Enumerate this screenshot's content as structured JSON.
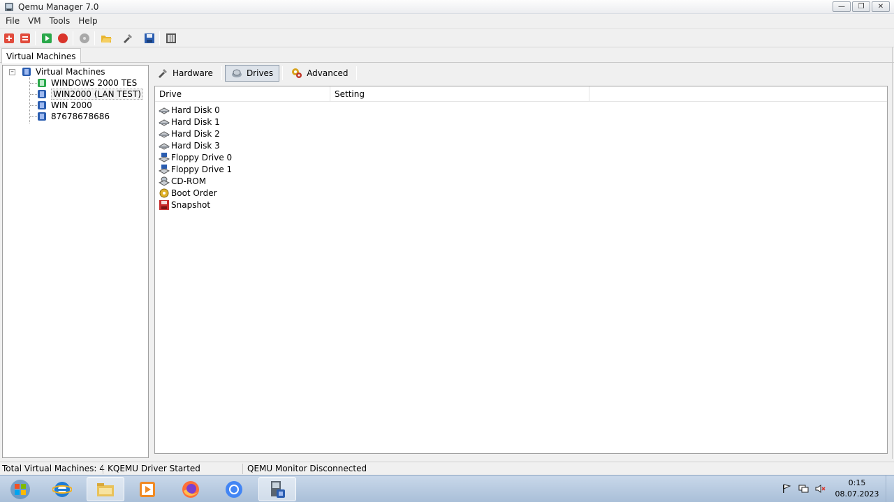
{
  "window": {
    "title": "Qemu Manager 7.0",
    "controls": [
      "minimize",
      "maximize",
      "close"
    ]
  },
  "menu": [
    "File",
    "VM",
    "Tools",
    "Help"
  ],
  "toolbar": {
    "buttons": [
      "add-vm",
      "remove-vm",
      "start-vm",
      "stop-vm",
      "disc",
      "open-folder",
      "settings",
      "save",
      "monitor"
    ]
  },
  "left_tab": "Virtual Machines",
  "tree": {
    "root": "Virtual Machines",
    "items": [
      "WINDOWS 2000 TES",
      "WIN2000 (LAN TEST)",
      "WIN 2000",
      "87678678686"
    ]
  },
  "subtabs": {
    "hardware": "Hardware",
    "drives": "Drives",
    "advanced": "Advanced"
  },
  "listview": {
    "columns": [
      "Drive",
      "Setting"
    ],
    "rows": [
      "Hard Disk 0",
      "Hard Disk 1",
      "Hard Disk 2",
      "Hard Disk 3",
      "Floppy Drive 0",
      "Floppy Drive 1",
      "CD-ROM",
      "Boot Order",
      "Snapshot"
    ]
  },
  "statusbar": {
    "total": "Total Virtual Machines: 4",
    "driver": "KQEMU Driver Started",
    "monitor": "QEMU Monitor Disconnected"
  },
  "taskbar": {
    "apps": [
      "start",
      "internet-explorer",
      "file-explorer",
      "media-player",
      "firefox",
      "chrome",
      "qemu-manager"
    ],
    "clock_time": "0:15",
    "clock_date": "08.07.2023"
  },
  "colors": {
    "accent_green": "#2aa84a",
    "accent_red": "#d9342b",
    "vm_blue": "#2a5db0"
  }
}
